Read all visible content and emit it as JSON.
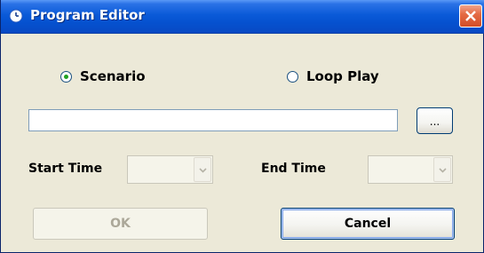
{
  "window": {
    "title": "Program Editor",
    "icon": "clock-icon",
    "close_icon": "close-icon"
  },
  "mode": {
    "options": [
      {
        "label": "Scenario",
        "checked": true
      },
      {
        "label": "Loop Play",
        "checked": false
      }
    ]
  },
  "path": {
    "value": "",
    "browse_label": "..."
  },
  "start_time": {
    "label": "Start Time",
    "value": ""
  },
  "end_time": {
    "label": "End Time",
    "value": ""
  },
  "buttons": {
    "ok": "OK",
    "cancel": "Cancel"
  },
  "colors": {
    "titlebar": "#0a5ad8",
    "close": "#d34d26",
    "face": "#ece9d8",
    "radio_dot": "#21a121"
  }
}
